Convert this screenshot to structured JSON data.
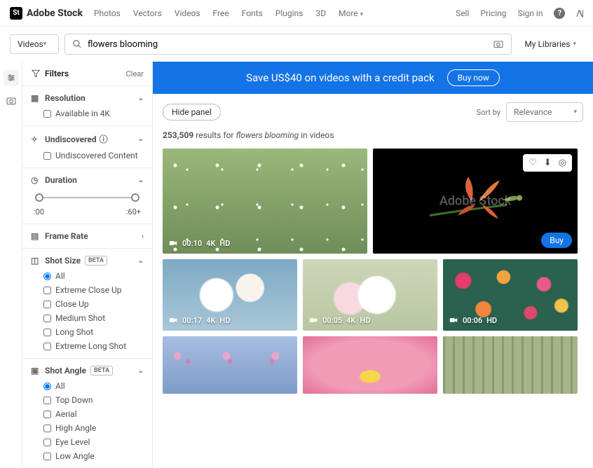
{
  "brand": "Adobe Stock",
  "nav": [
    "Photos",
    "Vectors",
    "Videos",
    "Free",
    "Fonts",
    "Plugins",
    "3D",
    "More"
  ],
  "topRight": {
    "sell": "Sell",
    "pricing": "Pricing",
    "signin": "Sign in"
  },
  "search": {
    "category": "Videos",
    "query": "flowers blooming",
    "libraries": "My Libraries"
  },
  "filters": {
    "title": "Filters",
    "clear": "Clear",
    "resolution": {
      "label": "Resolution",
      "items": [
        "Available in 4K"
      ]
    },
    "undiscovered": {
      "label": "Undiscovered",
      "items": [
        "Undiscovered Content"
      ]
    },
    "duration": {
      "label": "Duration",
      "min": ":00",
      "max": ":60+"
    },
    "framerate": {
      "label": "Frame Rate"
    },
    "shotsize": {
      "label": "Shot Size",
      "badge": "BETA",
      "items": [
        "All",
        "Extreme Close Up",
        "Close Up",
        "Medium Shot",
        "Long Shot",
        "Extreme Long Shot"
      ],
      "selected": 0
    },
    "shotangle": {
      "label": "Shot Angle",
      "badge": "BETA",
      "items": [
        "All",
        "Top Down",
        "Aerial",
        "High Angle",
        "Eye Level",
        "Low Angle"
      ],
      "selected": 0
    }
  },
  "promo": {
    "text": "Save US$40 on videos with a credit pack",
    "cta": "Buy now"
  },
  "toolbar": {
    "hide": "Hide panel",
    "sortby": "Sort by",
    "sort": "Relevance"
  },
  "results": {
    "count": "253,509",
    "pre": "results for",
    "term": "flowers blooming",
    "post": "in videos"
  },
  "watermark": "Adobe Stock",
  "buy": "Buy",
  "tiles": [
    {
      "dur": "00:10",
      "tags": [
        "4K",
        "HD"
      ]
    },
    {
      "dur": "",
      "tags": []
    },
    {
      "dur": "00:17",
      "tags": [
        "4K",
        "HD"
      ]
    },
    {
      "dur": "00:05",
      "tags": [
        "4K",
        "HD"
      ]
    },
    {
      "dur": "00:06",
      "tags": [
        "HD"
      ]
    },
    {
      "dur": "",
      "tags": []
    },
    {
      "dur": "",
      "tags": []
    },
    {
      "dur": "",
      "tags": []
    }
  ]
}
